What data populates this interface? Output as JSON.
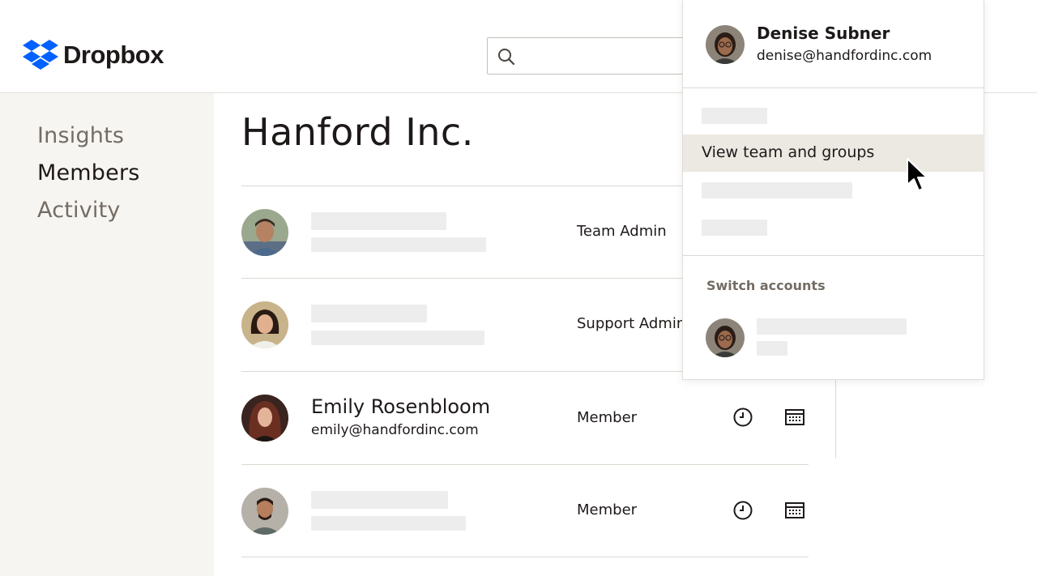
{
  "header": {
    "brand": "Dropbox",
    "brand_color": "#0061fe",
    "search": {
      "icon": "search-icon",
      "placeholder": ""
    }
  },
  "sidebar": {
    "items": [
      {
        "label": "Insights",
        "state": "inactive"
      },
      {
        "label": "Members",
        "state": "active"
      },
      {
        "label": "Activity",
        "state": "inactive"
      }
    ]
  },
  "main": {
    "title": "Hanford Inc.",
    "members": [
      {
        "name": "",
        "email": "",
        "role": "Team Admin"
      },
      {
        "name": "",
        "email": "",
        "role": "Support Admin"
      },
      {
        "name": "Emily Rosenbloom",
        "email": "emily@handfordinc.com",
        "role": "Member",
        "icons": [
          "clock-icon",
          "calendar-icon"
        ]
      },
      {
        "name": "",
        "email": "",
        "role": "Member",
        "icons": [
          "clock-icon",
          "calendar-icon"
        ]
      }
    ]
  },
  "account_menu": {
    "user": {
      "name": "Denise Subner",
      "email": "denise@handfordinc.com"
    },
    "items": [
      {
        "label": ""
      },
      {
        "label": "View team and groups",
        "state": "hover"
      },
      {
        "label": ""
      },
      {
        "label": ""
      }
    ],
    "switch_section_label": "Switch accounts"
  },
  "colors": {
    "sidebar_bg": "#f7f5f2",
    "hover_bg": "#ece8e2",
    "muted_text": "#736c64",
    "placeholder": "#ededed"
  }
}
